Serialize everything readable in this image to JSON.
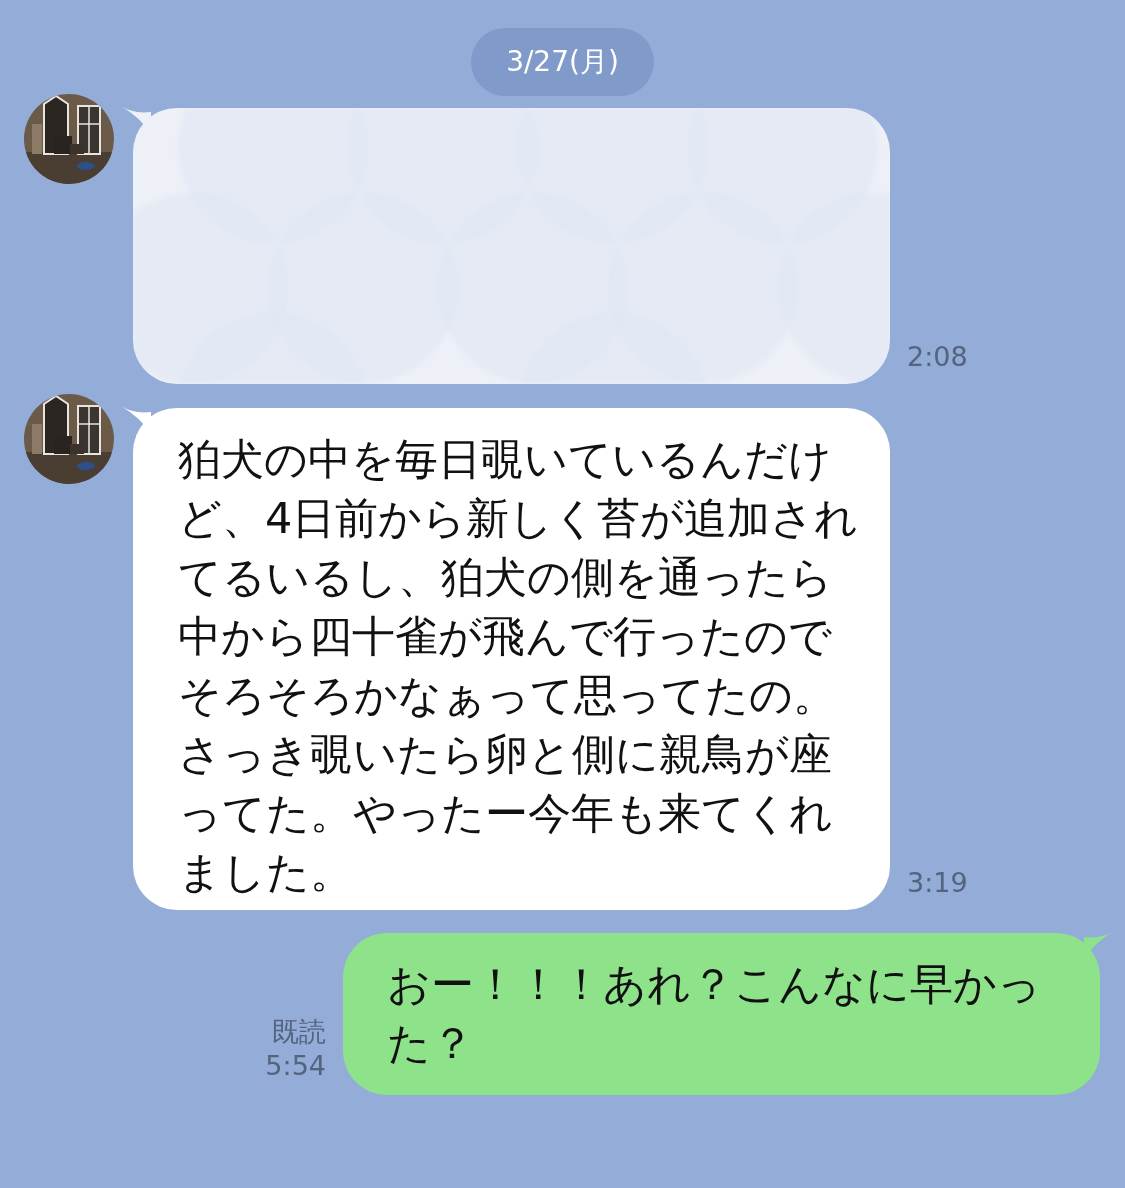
{
  "date": "3/27(月)",
  "messages": [
    {
      "kind": "obscured",
      "time": "2:08"
    },
    {
      "kind": "received",
      "paragraphs": [
        "狛犬の中を毎日覗いているんだけど、4日前から新しく苔が追加されてるいるし、狛犬の側を通ったら中から四十雀が飛んで行ったのでそろそろかなぁって思ってたの。",
        "さっき覗いたら卵と側に親鳥が座ってた。やったー今年も来てくれました。"
      ],
      "time": "3:19"
    },
    {
      "kind": "sent",
      "paragraphs": [
        "おー！！！あれ？こんなに早かった？"
      ],
      "read": "既読",
      "time": "5:54"
    }
  ]
}
